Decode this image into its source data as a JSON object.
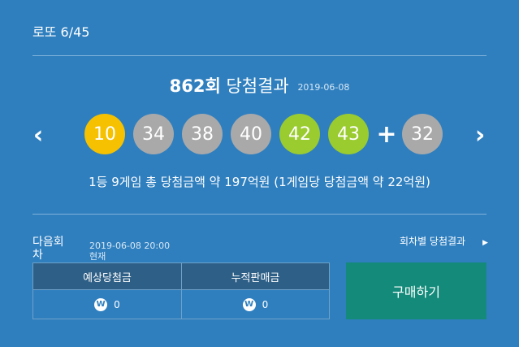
{
  "header": {
    "title": "로또 6/45"
  },
  "draw": {
    "round": "862회",
    "label": "당첨결과",
    "date": "2019-06-08",
    "balls": [
      {
        "value": "10",
        "color": "#f5c100"
      },
      {
        "value": "34",
        "color": "#a9a9a9"
      },
      {
        "value": "38",
        "color": "#a9a9a9"
      },
      {
        "value": "40",
        "color": "#a9a9a9"
      },
      {
        "value": "42",
        "color": "#9acb2f"
      },
      {
        "value": "43",
        "color": "#9acb2f"
      }
    ],
    "plus": "+",
    "bonus": {
      "value": "32",
      "color": "#a9a9a9"
    },
    "prev_icon": "chevron-left-icon",
    "next_icon": "chevron-right-icon",
    "prize_text": "1등 9게임 총 당첨금액 약 197억원 (1게임당 당첨금액 약 22억원)"
  },
  "next": {
    "label": "다음회차",
    "time": "2019-06-08 20:00 현재",
    "per_round_link": "회차별 당첨결과"
  },
  "stats": {
    "expected_label": "예상당첨금",
    "expected_value": "0",
    "accum_label": "누적판매금",
    "accum_value": "0",
    "currency_symbol": "W"
  },
  "buy_button": "구매하기"
}
